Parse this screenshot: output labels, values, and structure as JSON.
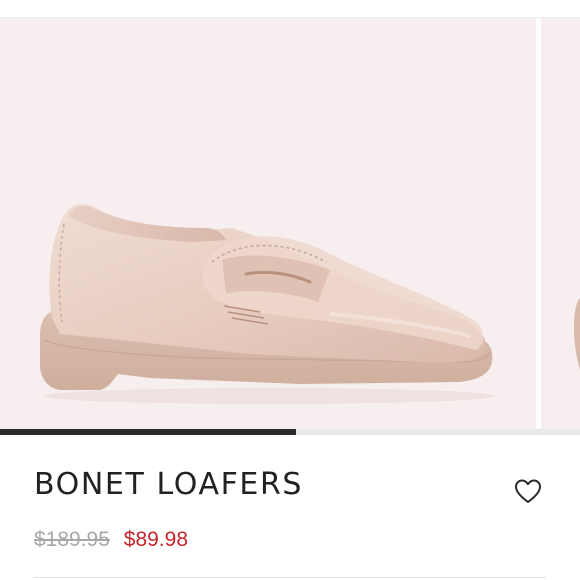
{
  "product": {
    "title": "BONET LOAFERS",
    "original_price": "$189.95",
    "sale_price": "$89.98"
  },
  "carousel": {
    "progress": 0.51,
    "image_subject": "blush suede penny loafer"
  },
  "icons": {
    "like": "heart-outline-icon"
  },
  "colors": {
    "sale_price": "#c8242b",
    "original_price": "#a8a8a8",
    "title": "#222222",
    "progress_fill": "#2b2b2b",
    "image_background": "#f7efef"
  }
}
